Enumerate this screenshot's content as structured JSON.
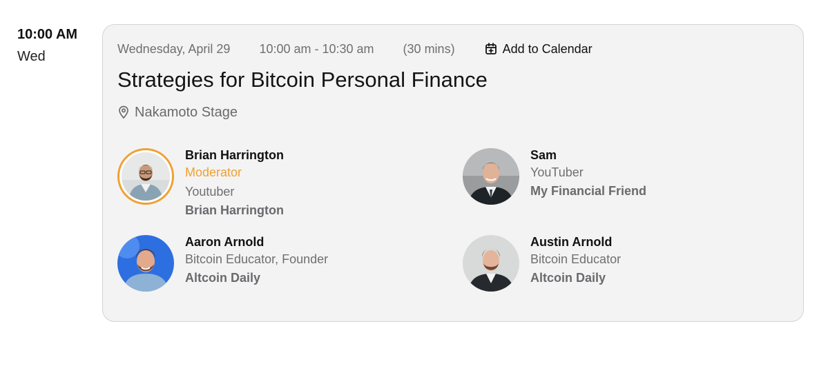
{
  "slot": {
    "time": "10:00 AM",
    "day": "Wed"
  },
  "session": {
    "date": "Wednesday, April 29",
    "time_range": "10:00 am - 10:30 am",
    "duration": "(30 mins)",
    "add_to_calendar": "Add to Calendar",
    "title": "Strategies for Bitcoin Personal Finance",
    "location": "Nakamoto Stage"
  },
  "speakers": [
    {
      "name": "Brian Harrington",
      "badge": "Moderator",
      "role": "Youtuber",
      "org": "Brian Harrington"
    },
    {
      "name": "Sam",
      "role": "YouTuber",
      "org": "My Financial Friend"
    },
    {
      "name": "Aaron Arnold",
      "role": "Bitcoin Educator, Founder",
      "org": "Altcoin Daily"
    },
    {
      "name": "Austin Arnold",
      "role": "Bitcoin Educator",
      "org": "Altcoin Daily"
    }
  ],
  "icons": {
    "calendar": "calendar-plus-icon",
    "location": "map-pin-icon"
  },
  "colors": {
    "moderator_accent": "#f0a032",
    "card_bg": "#f3f3f3",
    "muted_text": "#6f6f73"
  }
}
